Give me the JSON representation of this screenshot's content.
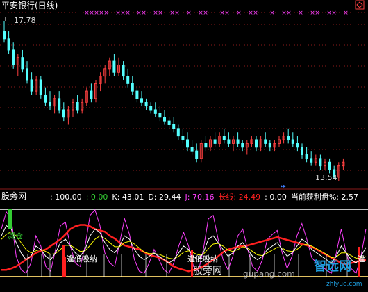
{
  "colors": {
    "up": "#ff4040",
    "down": "#54ffff",
    "top_marker": "#ff40ff",
    "kdj_k": "#ffffff",
    "kdj_d": "#ffff00",
    "kdj_j": "#ff40ff",
    "long_line": "#ff2020",
    "grid": "#8b1a1a",
    "title": "#ffffff",
    "accent_green": "#33cc33"
  },
  "upper_panel": {
    "title": "平安银行(日线)",
    "top_marker_glyph": "×",
    "high_label": "17.78",
    "low_label": "13.54",
    "right_icon": "diamond-arrow-icon"
  },
  "lower_panel": {
    "name": "股旁网",
    "fields": [
      {
        "label": "",
        "value": ": 100.00",
        "color": "#ffffff"
      },
      {
        "label": "",
        "value": ": 0.00",
        "color": "#33cc33"
      },
      {
        "label": "K:",
        "value": "43.01",
        "color": "#ffffff"
      },
      {
        "label": "D:",
        "value": "29.44",
        "color": "#ffffff"
      },
      {
        "label": "J:",
        "value": "70.16",
        "color": "#ff40ff"
      },
      {
        "label": "长线:",
        "value": "24.49",
        "color": "#ff2020"
      },
      {
        "label": "",
        "value": ": 0.00",
        "color": "#ffffff"
      },
      {
        "label": "当前获利盘%:",
        "value": "2.57",
        "color": "#ffffff"
      }
    ],
    "annotations": {
      "reduce": "减仓",
      "buy_low_1": "逢低吸纳",
      "buy_low_2": "逢低吸纳",
      "edge_marker": "逢"
    },
    "watermark": {
      "site": "股旁网",
      "url": "gupang.com",
      "brand": "智远网",
      "brand_url": "zhiyue.com"
    }
  },
  "chart_data": [
    {
      "type": "candlestick",
      "title": "平安银行(日线)",
      "y_range": [
        13.54,
        17.78
      ],
      "annotations": [
        {
          "label": "17.78",
          "kind": "high"
        },
        {
          "label": "13.54",
          "kind": "low"
        }
      ],
      "candles": [
        [
          17.5,
          17.78,
          17.2,
          17.3
        ],
        [
          17.3,
          17.5,
          16.9,
          17.0
        ],
        [
          17.0,
          17.2,
          16.5,
          16.6
        ],
        [
          16.6,
          16.9,
          16.3,
          16.8
        ],
        [
          16.8,
          17.0,
          16.4,
          16.5
        ],
        [
          16.5,
          16.7,
          16.1,
          16.2
        ],
        [
          16.2,
          16.4,
          15.8,
          15.9
        ],
        [
          15.9,
          16.3,
          15.8,
          16.2
        ],
        [
          16.2,
          16.3,
          15.7,
          15.8
        ],
        [
          15.8,
          16.0,
          15.5,
          15.6
        ],
        [
          15.6,
          15.9,
          15.4,
          15.5
        ],
        [
          15.5,
          15.8,
          15.3,
          15.7
        ],
        [
          15.7,
          15.9,
          15.3,
          15.4
        ],
        [
          15.4,
          15.6,
          15.1,
          15.2
        ],
        [
          15.2,
          15.5,
          15.0,
          15.4
        ],
        [
          15.4,
          15.7,
          15.2,
          15.6
        ],
        [
          15.6,
          15.8,
          15.3,
          15.4
        ],
        [
          15.4,
          15.7,
          15.3,
          15.6
        ],
        [
          15.6,
          16.0,
          15.5,
          15.9
        ],
        [
          15.9,
          16.1,
          15.6,
          15.7
        ],
        [
          15.7,
          16.2,
          15.6,
          16.1
        ],
        [
          16.1,
          16.4,
          15.9,
          16.3
        ],
        [
          16.3,
          16.6,
          16.1,
          16.5
        ],
        [
          16.5,
          16.8,
          16.3,
          16.7
        ],
        [
          16.7,
          16.9,
          16.3,
          16.4
        ],
        [
          16.4,
          16.8,
          16.3,
          16.6
        ],
        [
          16.6,
          16.7,
          16.2,
          16.3
        ],
        [
          16.3,
          16.5,
          16.0,
          16.1
        ],
        [
          16.1,
          16.3,
          15.8,
          15.9
        ],
        [
          15.9,
          16.0,
          15.6,
          15.7
        ],
        [
          15.7,
          15.9,
          15.5,
          15.6
        ],
        [
          15.6,
          15.7,
          15.4,
          15.5
        ],
        [
          15.5,
          15.6,
          15.3,
          15.4
        ],
        [
          15.4,
          15.6,
          15.2,
          15.3
        ],
        [
          15.3,
          15.5,
          15.1,
          15.2
        ],
        [
          15.2,
          15.4,
          15.0,
          15.1
        ],
        [
          15.1,
          15.2,
          14.9,
          15.0
        ],
        [
          15.0,
          15.2,
          14.8,
          14.9
        ],
        [
          14.9,
          15.0,
          14.6,
          14.7
        ],
        [
          14.7,
          14.9,
          14.5,
          14.6
        ],
        [
          14.6,
          14.8,
          14.3,
          14.4
        ],
        [
          14.4,
          14.6,
          14.2,
          14.3
        ],
        [
          14.3,
          14.5,
          14.0,
          14.1
        ],
        [
          14.1,
          14.6,
          14.0,
          14.5
        ],
        [
          14.5,
          14.7,
          14.3,
          14.4
        ],
        [
          14.4,
          14.7,
          14.3,
          14.6
        ],
        [
          14.6,
          14.8,
          14.4,
          14.5
        ],
        [
          14.5,
          14.8,
          14.4,
          14.7
        ],
        [
          14.7,
          14.9,
          14.5,
          14.6
        ],
        [
          14.6,
          14.8,
          14.4,
          14.5
        ],
        [
          14.5,
          14.7,
          14.3,
          14.6
        ],
        [
          14.6,
          14.8,
          14.4,
          14.5
        ],
        [
          14.5,
          14.6,
          14.3,
          14.4
        ],
        [
          14.4,
          14.6,
          14.2,
          14.5
        ],
        [
          14.5,
          14.7,
          14.4,
          14.6
        ],
        [
          14.6,
          14.7,
          14.3,
          14.4
        ],
        [
          14.4,
          14.7,
          14.3,
          14.6
        ],
        [
          14.6,
          14.8,
          14.4,
          14.5
        ],
        [
          14.5,
          14.6,
          14.3,
          14.4
        ],
        [
          14.4,
          14.6,
          14.3,
          14.5
        ],
        [
          14.5,
          14.7,
          14.4,
          14.6
        ],
        [
          14.6,
          14.8,
          14.5,
          14.7
        ],
        [
          14.7,
          14.9,
          14.5,
          14.6
        ],
        [
          14.6,
          14.8,
          14.4,
          14.5
        ],
        [
          14.5,
          14.7,
          14.3,
          14.4
        ],
        [
          14.4,
          14.5,
          14.1,
          14.2
        ],
        [
          14.2,
          14.4,
          14.0,
          14.1
        ],
        [
          14.1,
          14.3,
          13.9,
          14.0
        ],
        [
          14.0,
          14.2,
          13.9,
          14.1
        ],
        [
          14.1,
          14.2,
          13.8,
          13.9
        ],
        [
          13.9,
          14.1,
          13.8,
          14.0
        ],
        [
          14.0,
          14.1,
          13.7,
          13.8
        ],
        [
          13.8,
          13.9,
          13.54,
          13.6
        ],
        [
          13.6,
          14.0,
          13.5,
          13.9
        ],
        [
          13.9,
          14.1,
          13.8,
          14.0
        ]
      ]
    },
    {
      "type": "line",
      "series": [
        {
          "name": "K",
          "color": "#ffffff",
          "values": [
            60,
            75,
            70,
            50,
            35,
            25,
            30,
            45,
            40,
            30,
            25,
            35,
            50,
            55,
            45,
            35,
            30,
            40,
            60,
            70,
            65,
            50,
            40,
            35,
            45,
            60,
            55,
            40,
            30,
            25,
            30,
            35,
            30,
            25,
            20,
            25,
            35,
            45,
            40,
            30,
            25,
            35,
            55,
            60,
            50,
            40,
            30,
            35,
            45,
            50,
            40,
            30,
            25,
            30,
            40,
            45,
            50,
            40,
            30,
            35,
            45,
            55,
            50,
            40,
            35,
            30,
            25,
            20,
            30,
            45,
            35,
            25,
            20,
            30,
            43.01
          ]
        },
        {
          "name": "D",
          "color": "#ffff00",
          "values": [
            55,
            62,
            66,
            60,
            50,
            40,
            35,
            38,
            40,
            37,
            33,
            34,
            40,
            46,
            46,
            42,
            37,
            38,
            46,
            55,
            60,
            56,
            50,
            44,
            44,
            50,
            52,
            48,
            42,
            36,
            34,
            34,
            33,
            30,
            27,
            26,
            30,
            36,
            38,
            35,
            32,
            33,
            41,
            48,
            49,
            45,
            39,
            37,
            40,
            44,
            42,
            37,
            32,
            31,
            35,
            39,
            43,
            42,
            38,
            37,
            40,
            46,
            48,
            45,
            41,
            37,
            33,
            28,
            29,
            35,
            35,
            31,
            27,
            28,
            29.44
          ]
        },
        {
          "name": "J",
          "color": "#ff40ff",
          "values": [
            70,
            95,
            85,
            30,
            10,
            5,
            20,
            60,
            45,
            15,
            8,
            40,
            75,
            80,
            45,
            20,
            15,
            45,
            90,
            98,
            75,
            35,
            20,
            15,
            50,
            85,
            62,
            25,
            8,
            5,
            20,
            40,
            25,
            10,
            5,
            20,
            45,
            65,
            45,
            15,
            8,
            40,
            85,
            90,
            55,
            25,
            10,
            30,
            60,
            70,
            40,
            15,
            8,
            25,
            55,
            62,
            68,
            35,
            12,
            30,
            60,
            78,
            55,
            28,
            20,
            15,
            10,
            5,
            35,
            70,
            35,
            12,
            5,
            30,
            70.16
          ]
        },
        {
          "name": "长线",
          "color": "#ff2020",
          "values": [
            10,
            10,
            12,
            15,
            20,
            25,
            30,
            35,
            38,
            40,
            45,
            50,
            55,
            62,
            70,
            74,
            76,
            76,
            74,
            70,
            68,
            66,
            60,
            56,
            50,
            46,
            44,
            42,
            40,
            36,
            32,
            30,
            28,
            25,
            20,
            15,
            12,
            10,
            8,
            10,
            12,
            15,
            20,
            25,
            30,
            36,
            40,
            42,
            44,
            45,
            46,
            48,
            50,
            52,
            54,
            56,
            58,
            56,
            54,
            52,
            50,
            48,
            46,
            44,
            40,
            36,
            32,
            28,
            24,
            20,
            18,
            20,
            22,
            24,
            24.49
          ]
        }
      ]
    }
  ]
}
